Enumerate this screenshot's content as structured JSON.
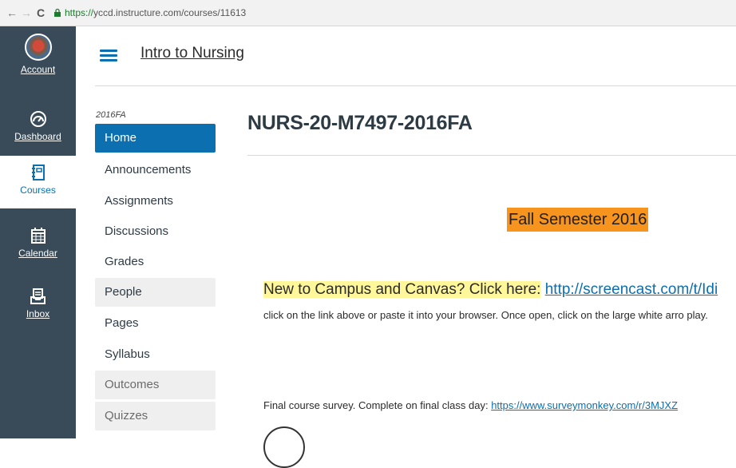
{
  "browser": {
    "back_icon": "←",
    "forward_icon": "→",
    "reload_icon": "C",
    "url_secure": "https://",
    "url_rest": "yccd.instructure.com/courses/11613"
  },
  "global_nav": {
    "items": [
      {
        "label": "Account",
        "icon": "avatar"
      },
      {
        "label": "Dashboard",
        "icon": "dashboard-icon"
      },
      {
        "label": "Courses",
        "icon": "courses-icon"
      },
      {
        "label": "Calendar",
        "icon": "calendar-icon"
      },
      {
        "label": "Inbox",
        "icon": "inbox-icon"
      }
    ],
    "active_color": "#0b6fb0",
    "bg_color": "#394b58"
  },
  "header": {
    "course_name": "Intro to Nursing"
  },
  "course_nav": {
    "term": "2016FA",
    "items": [
      {
        "label": "Home"
      },
      {
        "label": "Announcements"
      },
      {
        "label": "Assignments"
      },
      {
        "label": "Discussions"
      },
      {
        "label": "Grades"
      },
      {
        "label": "People"
      },
      {
        "label": "Pages"
      },
      {
        "label": "Syllabus"
      },
      {
        "label": "Outcomes"
      },
      {
        "label": "Quizzes"
      }
    ]
  },
  "main": {
    "title": "NURS-20-M7497-2016FA",
    "semester": "Fall Semester 2016",
    "new_campus_text": "New to Campus and Canvas?  Click here:",
    "new_campus_link": "http://screencast.com/t/Idi",
    "instructions": "click on the link above or paste it into your browser.  Once open, click on the large white arro play.",
    "survey_text": "Final course survey.  Complete on final class day:",
    "survey_link": "https://www.surveymonkey.com/r/3MJXZ"
  }
}
